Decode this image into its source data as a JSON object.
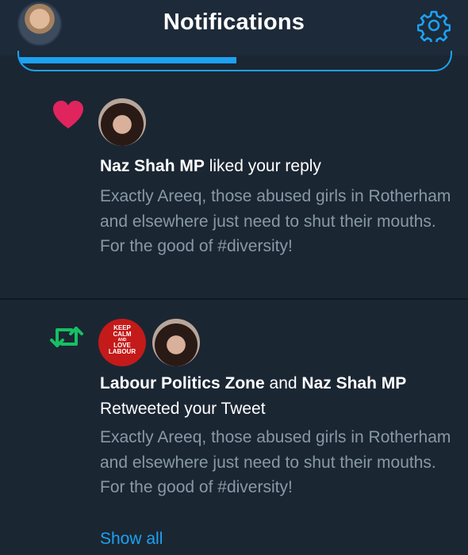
{
  "header": {
    "title": "Notifications",
    "settings_icon": "gear-icon",
    "profile_avatar": "avatar"
  },
  "tabs": {
    "active_fraction": 0.5
  },
  "notifications": [
    {
      "type": "like",
      "icon": "heart-icon",
      "icon_color": "#e0245e",
      "actor": "Naz Shah MP",
      "action": "liked your reply",
      "text": "Exactly Areeq, those abused girls in Rotherham and elsewhere just need to shut their mouths. For the good of #diversity!"
    },
    {
      "type": "retweet",
      "icon": "retweet-icon",
      "icon_color": "#17bf63",
      "actor1": "Labour Politics Zone",
      "connector": "and",
      "actor2": "Naz Shah MP",
      "action": "Retweeted your Tweet",
      "avatar_text": {
        "line1": "KEEP",
        "line2": "CALM",
        "line3": "AND",
        "line4": "LOVE",
        "line5": "LABOUR"
      },
      "text": "Exactly Areeq, those abused girls in Rotherham and elsewhere just need to shut their mouths. For the good of #diversity!",
      "show_all": "Show all"
    }
  ],
  "colors": {
    "background": "#1b2633",
    "accent": "#1da1f2",
    "secondary_text": "#8899a6"
  }
}
